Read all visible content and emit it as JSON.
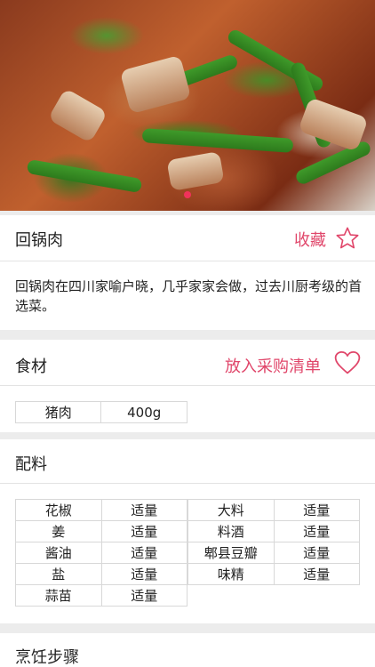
{
  "hero": {
    "image": "回锅肉 dish photo",
    "indicator_count": 1
  },
  "dish": {
    "name": "回锅肉",
    "favorite_label": "收藏",
    "description": "回锅肉在四川家喻户晓，几乎家家会做，过去川厨考级的首选菜。"
  },
  "ingredients": {
    "title": "食材",
    "shopping_label": "放入采购清单",
    "items": [
      {
        "name": "猪肉",
        "amount": "400g"
      }
    ]
  },
  "seasonings": {
    "title": "配料",
    "items": [
      {
        "name": "花椒",
        "amount": "适量"
      },
      {
        "name": "大料",
        "amount": "适量"
      },
      {
        "name": "姜",
        "amount": "适量"
      },
      {
        "name": "料酒",
        "amount": "适量"
      },
      {
        "name": "酱油",
        "amount": "适量"
      },
      {
        "name": "郫县豆瓣",
        "amount": "适量"
      },
      {
        "name": "盐",
        "amount": "适量"
      },
      {
        "name": "味精",
        "amount": "适量"
      },
      {
        "name": "蒜苗",
        "amount": "适量"
      }
    ]
  },
  "steps": {
    "title": "烹饪步骤"
  },
  "colors": {
    "accent": "#e0466a",
    "background": "#ececec"
  }
}
